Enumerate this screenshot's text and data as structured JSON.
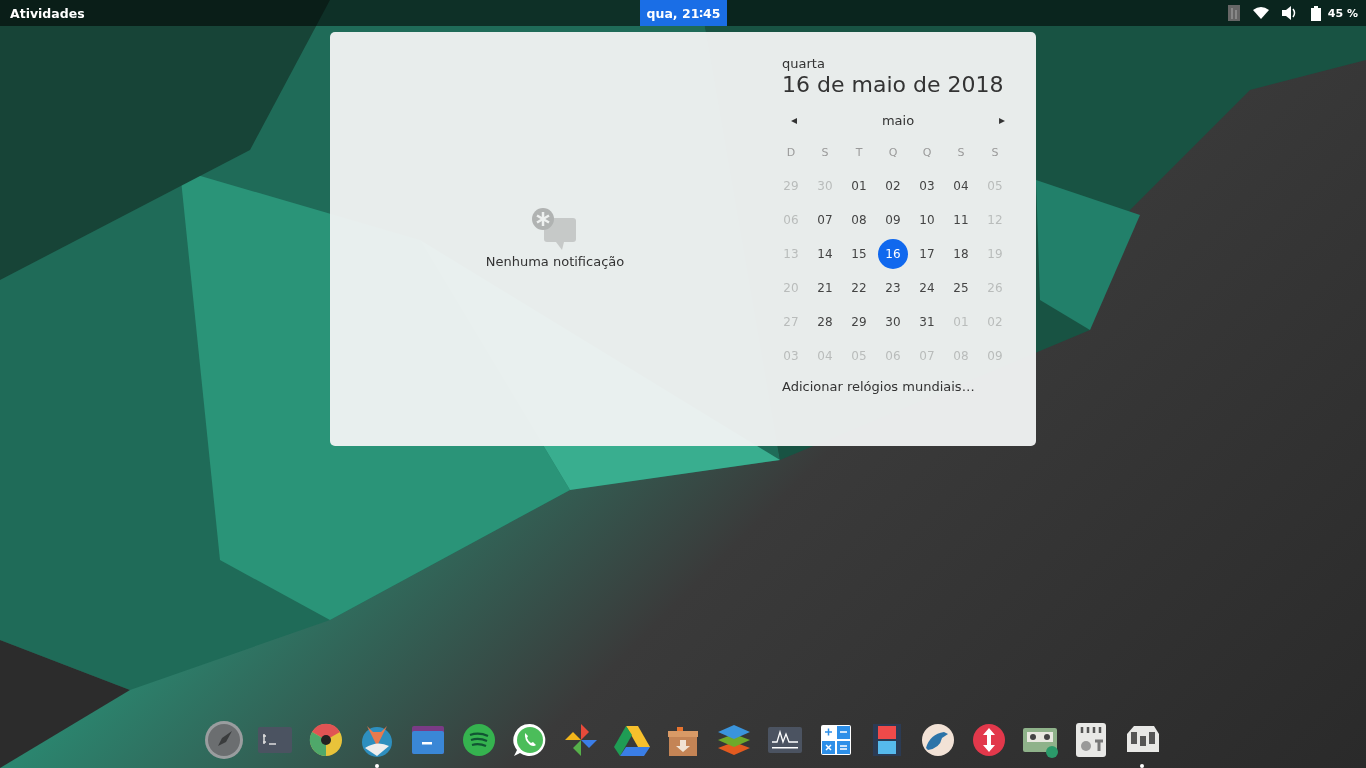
{
  "top_bar": {
    "activities": "Atividades",
    "clock": {
      "label": "qua, 21∶45",
      "selected": true
    },
    "battery": "45 %"
  },
  "notifications": {
    "empty_text": "Nenhuma notificação"
  },
  "calendar": {
    "weekday": "quarta",
    "date": "16 de maio de 2018",
    "month": "maio",
    "prev": "◂",
    "next": "▸",
    "headers": [
      "D",
      "S",
      "T",
      "Q",
      "Q",
      "S",
      "S"
    ],
    "weeks": [
      [
        {
          "day": "29",
          "dim": true,
          "selected": false
        },
        {
          "day": "30",
          "dim": true,
          "selected": false
        },
        {
          "day": "01",
          "dim": false,
          "selected": false
        },
        {
          "day": "02",
          "dim": false,
          "selected": false
        },
        {
          "day": "03",
          "dim": false,
          "selected": false
        },
        {
          "day": "04",
          "dim": false,
          "selected": false
        },
        {
          "day": "05",
          "dim": true,
          "selected": false
        }
      ],
      [
        {
          "day": "06",
          "dim": true,
          "selected": false
        },
        {
          "day": "07",
          "dim": false,
          "selected": false
        },
        {
          "day": "08",
          "dim": false,
          "selected": false
        },
        {
          "day": "09",
          "dim": false,
          "selected": false
        },
        {
          "day": "10",
          "dim": false,
          "selected": false
        },
        {
          "day": "11",
          "dim": false,
          "selected": false
        },
        {
          "day": "12",
          "dim": true,
          "selected": false
        }
      ],
      [
        {
          "day": "13",
          "dim": true,
          "selected": false
        },
        {
          "day": "14",
          "dim": false,
          "selected": false
        },
        {
          "day": "15",
          "dim": false,
          "selected": false
        },
        {
          "day": "16",
          "dim": false,
          "selected": true
        },
        {
          "day": "17",
          "dim": false,
          "selected": false
        },
        {
          "day": "18",
          "dim": false,
          "selected": false
        },
        {
          "day": "19",
          "dim": true,
          "selected": false
        }
      ],
      [
        {
          "day": "20",
          "dim": true,
          "selected": false
        },
        {
          "day": "21",
          "dim": false,
          "selected": false
        },
        {
          "day": "22",
          "dim": false,
          "selected": false
        },
        {
          "day": "23",
          "dim": false,
          "selected": false
        },
        {
          "day": "24",
          "dim": false,
          "selected": false
        },
        {
          "day": "25",
          "dim": false,
          "selected": false
        },
        {
          "day": "26",
          "dim": true,
          "selected": false
        }
      ],
      [
        {
          "day": "27",
          "dim": true,
          "selected": false
        },
        {
          "day": "28",
          "dim": false,
          "selected": false
        },
        {
          "day": "29",
          "dim": false,
          "selected": false
        },
        {
          "day": "30",
          "dim": false,
          "selected": false
        },
        {
          "day": "31",
          "dim": false,
          "selected": false
        },
        {
          "day": "01",
          "dim": true,
          "selected": false
        },
        {
          "day": "02",
          "dim": true,
          "selected": false
        }
      ],
      [
        {
          "day": "03",
          "dim": true,
          "selected": false
        },
        {
          "day": "04",
          "dim": true,
          "selected": false
        },
        {
          "day": "05",
          "dim": true,
          "selected": false
        },
        {
          "day": "06",
          "dim": true,
          "selected": false
        },
        {
          "day": "07",
          "dim": true,
          "selected": false
        },
        {
          "day": "08",
          "dim": true,
          "selected": false
        },
        {
          "day": "09",
          "dim": true,
          "selected": false
        }
      ]
    ],
    "world_clocks": "Adicionar relógios mundiais…"
  },
  "dock": [
    {
      "kind": "rocket",
      "running": false
    },
    {
      "kind": "terminal",
      "running": false
    },
    {
      "kind": "chrome",
      "running": false
    },
    {
      "kind": "fox",
      "running": true
    },
    {
      "kind": "folder",
      "running": false
    },
    {
      "kind": "spotify",
      "running": false
    },
    {
      "kind": "whatsapp",
      "running": false
    },
    {
      "kind": "pinwheel",
      "running": false
    },
    {
      "kind": "drive",
      "running": false
    },
    {
      "kind": "package",
      "running": false
    },
    {
      "kind": "layers",
      "running": false
    },
    {
      "kind": "monitor",
      "running": false
    },
    {
      "kind": "calculator",
      "running": false
    },
    {
      "kind": "film",
      "running": false
    },
    {
      "kind": "bird",
      "running": false
    },
    {
      "kind": "updown",
      "running": false
    },
    {
      "kind": "cassette",
      "running": false
    },
    {
      "kind": "mixer",
      "running": false
    },
    {
      "kind": "sliders",
      "running": true
    }
  ]
}
